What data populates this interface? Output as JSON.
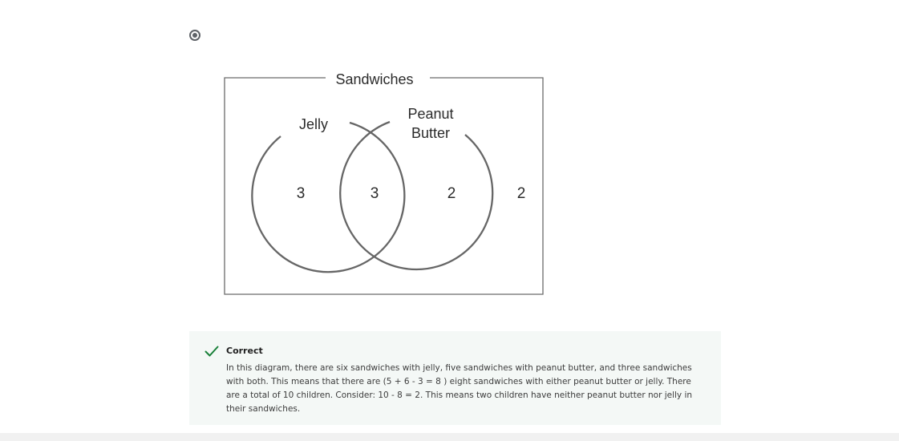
{
  "question": {
    "option_selected": true
  },
  "diagram": {
    "title": "Sandwiches",
    "set_left_label": "Jelly",
    "set_right_label_line1": "Peanut",
    "set_right_label_line2": "Butter",
    "count_left_only": "3",
    "count_both": "3",
    "count_right_only": "2",
    "count_neither": "2"
  },
  "feedback": {
    "status": "Correct",
    "status_icon": "check-icon",
    "status_color": "#188038",
    "explanation": "In this diagram, there are six sandwiches with jelly, five sandwiches with peanut butter, and three sandwiches with both. This means that there are (5 + 6 - 3 = 8 ) eight sandwiches with either peanut butter or jelly. There are a total of 10 children. Consider: 10 - 8 = 2. This means two children have neither peanut butter nor jelly in their sandwiches."
  }
}
